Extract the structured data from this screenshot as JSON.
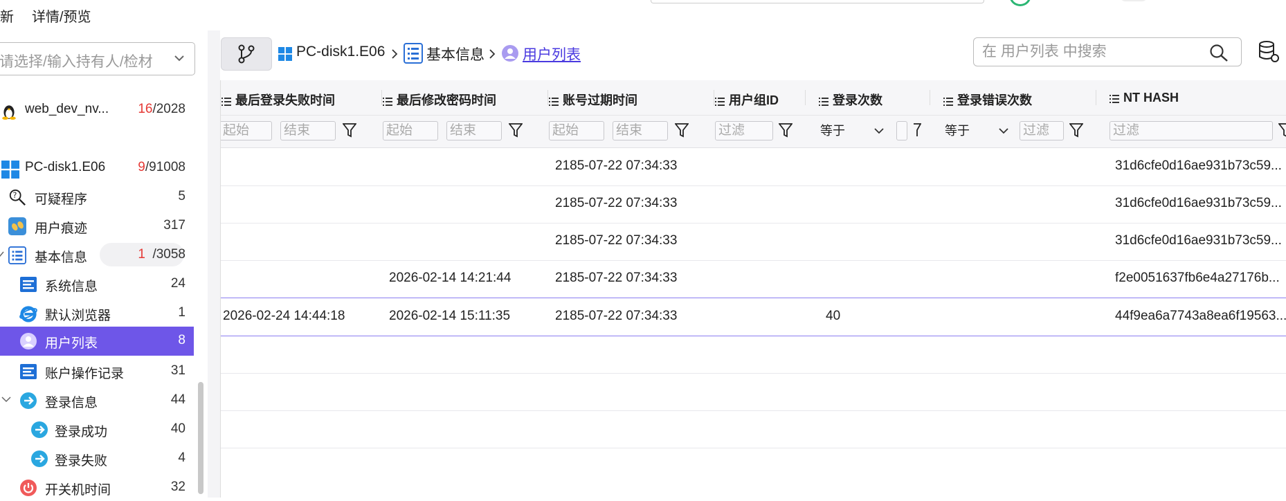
{
  "topbar": {
    "menu_new": "新",
    "menu_detail": "详情/预览"
  },
  "sidebar": {
    "owner_placeholder": "请选择/输入持有人/检材",
    "device_linux": {
      "label": "web_dev_nv...",
      "count_red": "16",
      "count_rest": "/2028"
    },
    "device_pc": {
      "label": "PC-disk1.E06",
      "count_red": "9",
      "count_rest": "/91008"
    },
    "items": [
      {
        "label": "可疑程序",
        "count": "5"
      },
      {
        "label": "用户痕迹",
        "count": "317"
      },
      {
        "label": "基本信息",
        "count_red": "1",
        "count_rest": "/3058"
      },
      {
        "label": "系统信息",
        "count": "24"
      },
      {
        "label": "默认浏览器",
        "count": "1"
      },
      {
        "label": "用户列表",
        "count": "8"
      },
      {
        "label": "账户操作记录",
        "count": "31"
      },
      {
        "label": "登录信息",
        "count": "44"
      },
      {
        "label": "登录成功",
        "count": "40"
      },
      {
        "label": "登录失败",
        "count": "4"
      },
      {
        "label": "开关机时间",
        "count": "32"
      }
    ]
  },
  "breadcrumb": {
    "device": "PC-disk1.E06",
    "section": "基本信息",
    "current": "用户列表"
  },
  "search": {
    "placeholder": "在 用户列表 中搜索"
  },
  "table": {
    "headers": [
      "最后登录失败时间",
      "最后修改密码时间",
      "账号过期时间",
      "用户组ID",
      "登录次数",
      "登录错误次数",
      "NT HASH"
    ],
    "filters": {
      "start": "起始",
      "end": "结束",
      "filter": "过滤",
      "equals": "等于"
    },
    "rows": [
      {
        "last_fail": "",
        "last_pwd": "",
        "expire": "2185-07-22 07:34:33",
        "gid": "",
        "logins": "",
        "errors": "",
        "nthash": "31d6cfe0d16ae931b73c59..."
      },
      {
        "last_fail": "",
        "last_pwd": "",
        "expire": "2185-07-22 07:34:33",
        "gid": "",
        "logins": "",
        "errors": "",
        "nthash": "31d6cfe0d16ae931b73c59..."
      },
      {
        "last_fail": "",
        "last_pwd": "",
        "expire": "2185-07-22 07:34:33",
        "gid": "",
        "logins": "",
        "errors": "",
        "nthash": "31d6cfe0d16ae931b73c59..."
      },
      {
        "last_fail": "",
        "last_pwd": "2026-02-14 14:21:44",
        "expire": "2185-07-22 07:34:33",
        "gid": "",
        "logins": "",
        "errors": "",
        "nthash": "f2e0051637fb6e4a27176b..."
      },
      {
        "last_fail": "2026-02-24 14:44:18",
        "last_pwd": "2026-02-14 15:11:35",
        "expire": "2185-07-22 07:34:33",
        "gid": "",
        "logins": "40",
        "errors": "",
        "nthash": "44f9ea6a7743a8ea6f19563..."
      }
    ]
  },
  "colors": {
    "accent": "#6e56e8",
    "red": "#e53935",
    "windows_blue": "#1e88e5"
  }
}
